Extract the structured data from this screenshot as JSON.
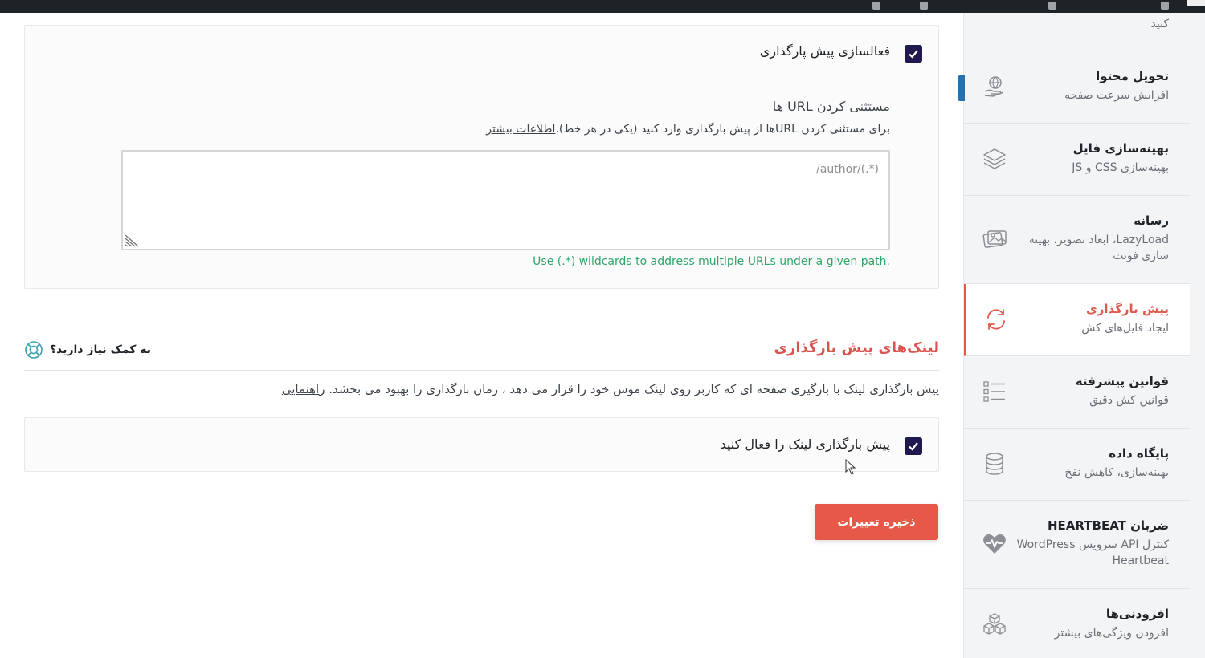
{
  "sidebar": {
    "top_fragment": "کنید",
    "items": [
      {
        "title": "تحویل محتوا",
        "subtitle": "افزایش سرعت صفحه",
        "icon": "cdn-globe-hand-icon",
        "active": false
      },
      {
        "title": "بهینه‌سازی فایل",
        "subtitle": "بهینه‌سازی CSS و JS",
        "icon": "layers-icon",
        "active": false
      },
      {
        "title": "رسانه",
        "subtitle": "LazyLoad، ابعاد تصویر، بهینه سازی فونت",
        "icon": "images-icon",
        "active": false
      },
      {
        "title": "پیش بارگذاری",
        "subtitle": "ایجاد فایل‌های کش",
        "icon": "refresh-icon",
        "active": true
      },
      {
        "title": "قوانین پیشرفته",
        "subtitle": "قوانین کش دقیق",
        "icon": "list-icon",
        "active": false
      },
      {
        "title": "پایگاه داده",
        "subtitle": "بهینه‌سازی، کاهش نفخ",
        "icon": "database-icon",
        "active": false
      },
      {
        "title": "ضربان HEARTBEAT",
        "subtitle": "کنترل API سرویس WordPress Heartbeat",
        "icon": "heartbeat-icon",
        "active": false
      },
      {
        "title": "افزودنی‌ها",
        "subtitle": "افزودن ویژگی‌های بیشتر",
        "icon": "cubes-icon",
        "active": false
      }
    ]
  },
  "preload_card": {
    "enable_label": "فعالسازی پیش پارگذاری",
    "enable_checked": true,
    "exclude_title": "مستثنی کردن URL ها",
    "exclude_desc": "برای مستثنی کردن URLها از پیش بارگذاری وارد کنید (یکی در هر خط).",
    "more_info_link": "اطلاعات بیشتر",
    "exclude_value": "/author/(.*)",
    "wildcard_hint": "Use (.*) wildcards to address multiple URLs under a given path."
  },
  "links_section": {
    "title": "لینک‌های پیش بارگذاری",
    "help_label": "به کمک نیاز دارید؟",
    "description": "پیش بارگذاری لینک با بارگیری صفحه ای که کاربر روی لینک موس خود را قرار می دهد ، زمان بارگذاری را بهبود می بخشد.",
    "guide_link": "راهنمایی",
    "enable_label": "پیش بارگذاری لینک را فعال کنید",
    "enable_checked": true
  },
  "save_button": "ذخیره تغییرات",
  "colors": {
    "accent": "#e65948",
    "checkbox": "#1e1a4d",
    "hint": "#2ea66a"
  }
}
